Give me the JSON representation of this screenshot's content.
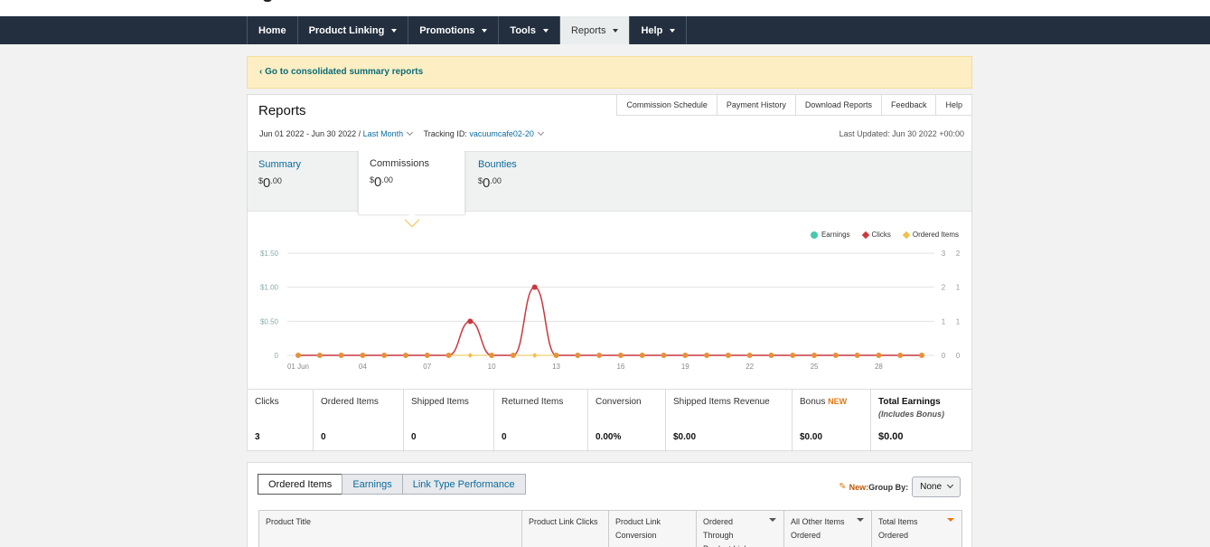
{
  "nav": {
    "items": [
      {
        "label": "Home",
        "caret": false,
        "active": false
      },
      {
        "label": "Product Linking",
        "caret": true,
        "active": false
      },
      {
        "label": "Promotions",
        "caret": true,
        "active": false
      },
      {
        "label": "Tools",
        "caret": true,
        "active": false
      },
      {
        "label": "Reports",
        "caret": true,
        "active": true
      },
      {
        "label": "Help",
        "caret": true,
        "active": false
      }
    ]
  },
  "banner": {
    "link": "‹ Go to consolidated summary reports"
  },
  "reports": {
    "title": "Reports",
    "top_links": [
      "Commission Schedule",
      "Payment History",
      "Download Reports",
      "Feedback",
      "Help"
    ],
    "date_range": "Jun 01 2022 - Jun 30 2022 / ",
    "period": "Last Month",
    "tracking_label": "Tracking ID: ",
    "tracking_id": "vacuumcafe02-20",
    "last_updated": "Last Updated: Jun 30 2022 +00:00",
    "tabs": [
      {
        "label": "Summary",
        "dollar": "$",
        "whole": "0",
        "cents": ".00"
      },
      {
        "label": "Commissions",
        "dollar": "$",
        "whole": "0",
        "cents": ".00"
      },
      {
        "label": "Bounties",
        "dollar": "$",
        "whole": "0",
        "cents": ".00"
      }
    ]
  },
  "chart_data": {
    "type": "line",
    "legend": [
      "Earnings",
      "Clicks",
      "Ordered Items"
    ],
    "colors": {
      "earnings": "#48c9b0",
      "clicks": "#c9393e",
      "ordered": "#f0c14b",
      "points": "#e8913a"
    },
    "x_ticks": [
      "01 Jun",
      "04",
      "07",
      "10",
      "13",
      "16",
      "19",
      "22",
      "25",
      "28"
    ],
    "y_left_ticks": [
      "0",
      "$0.50",
      "$1.00",
      "$1.50"
    ],
    "y_right1_ticks": [
      "0",
      "1",
      "2",
      "3"
    ],
    "y_right2_ticks": [
      "0",
      "1",
      "1",
      "2"
    ],
    "y_left_lim": [
      0,
      1.5
    ],
    "x": [
      1,
      2,
      3,
      4,
      5,
      6,
      7,
      8,
      9,
      10,
      11,
      12,
      13,
      14,
      15,
      16,
      17,
      18,
      19,
      20,
      21,
      22,
      23,
      24,
      25,
      26,
      27,
      28,
      29,
      30
    ],
    "series": [
      {
        "name": "Earnings",
        "values": [
          0,
          0,
          0,
          0,
          0,
          0,
          0,
          0,
          0,
          0,
          0,
          0,
          0,
          0,
          0,
          0,
          0,
          0,
          0,
          0,
          0,
          0,
          0,
          0,
          0,
          0,
          0,
          0,
          0,
          0
        ]
      },
      {
        "name": "Clicks",
        "values": [
          0,
          0,
          0,
          0,
          0,
          0,
          0,
          0,
          1,
          0,
          0,
          2,
          0,
          0,
          0,
          0,
          0,
          0,
          0,
          0,
          0,
          0,
          0,
          0,
          0,
          0,
          0,
          0,
          0,
          0
        ]
      },
      {
        "name": "Ordered Items",
        "values": [
          0,
          0,
          0,
          0,
          0,
          0,
          0,
          0,
          0,
          0,
          0,
          0,
          0,
          0,
          0,
          0,
          0,
          0,
          0,
          0,
          0,
          0,
          0,
          0,
          0,
          0,
          0,
          0,
          0,
          0
        ]
      }
    ],
    "grid": true,
    "legend_position": "top-right"
  },
  "metrics": [
    {
      "label": "Clicks",
      "value": "3"
    },
    {
      "label": "Ordered Items",
      "value": "0"
    },
    {
      "label": "Shipped Items",
      "value": "0"
    },
    {
      "label": "Returned Items",
      "value": "0"
    },
    {
      "label": "Conversion",
      "value": "0.00%"
    },
    {
      "label": "Shipped Items Revenue",
      "value": "$0.00"
    },
    {
      "label": "Bonus",
      "badge": "NEW",
      "value": "$0.00"
    },
    {
      "label": "Total Earnings",
      "sub": "(Includes Bonus)",
      "value": "$0.00"
    }
  ],
  "bottom": {
    "tabs": [
      "Ordered Items",
      "Earnings",
      "Link Type Performance"
    ],
    "new_label": "New:",
    "group_by_label": " Group By:",
    "group_by_value": "None",
    "columns": [
      "Product Title",
      "Product Link Clicks",
      "Product Link Conversion",
      "Ordered Through Product Links",
      "All Other Items Ordered",
      "Total Items Ordered"
    ]
  }
}
